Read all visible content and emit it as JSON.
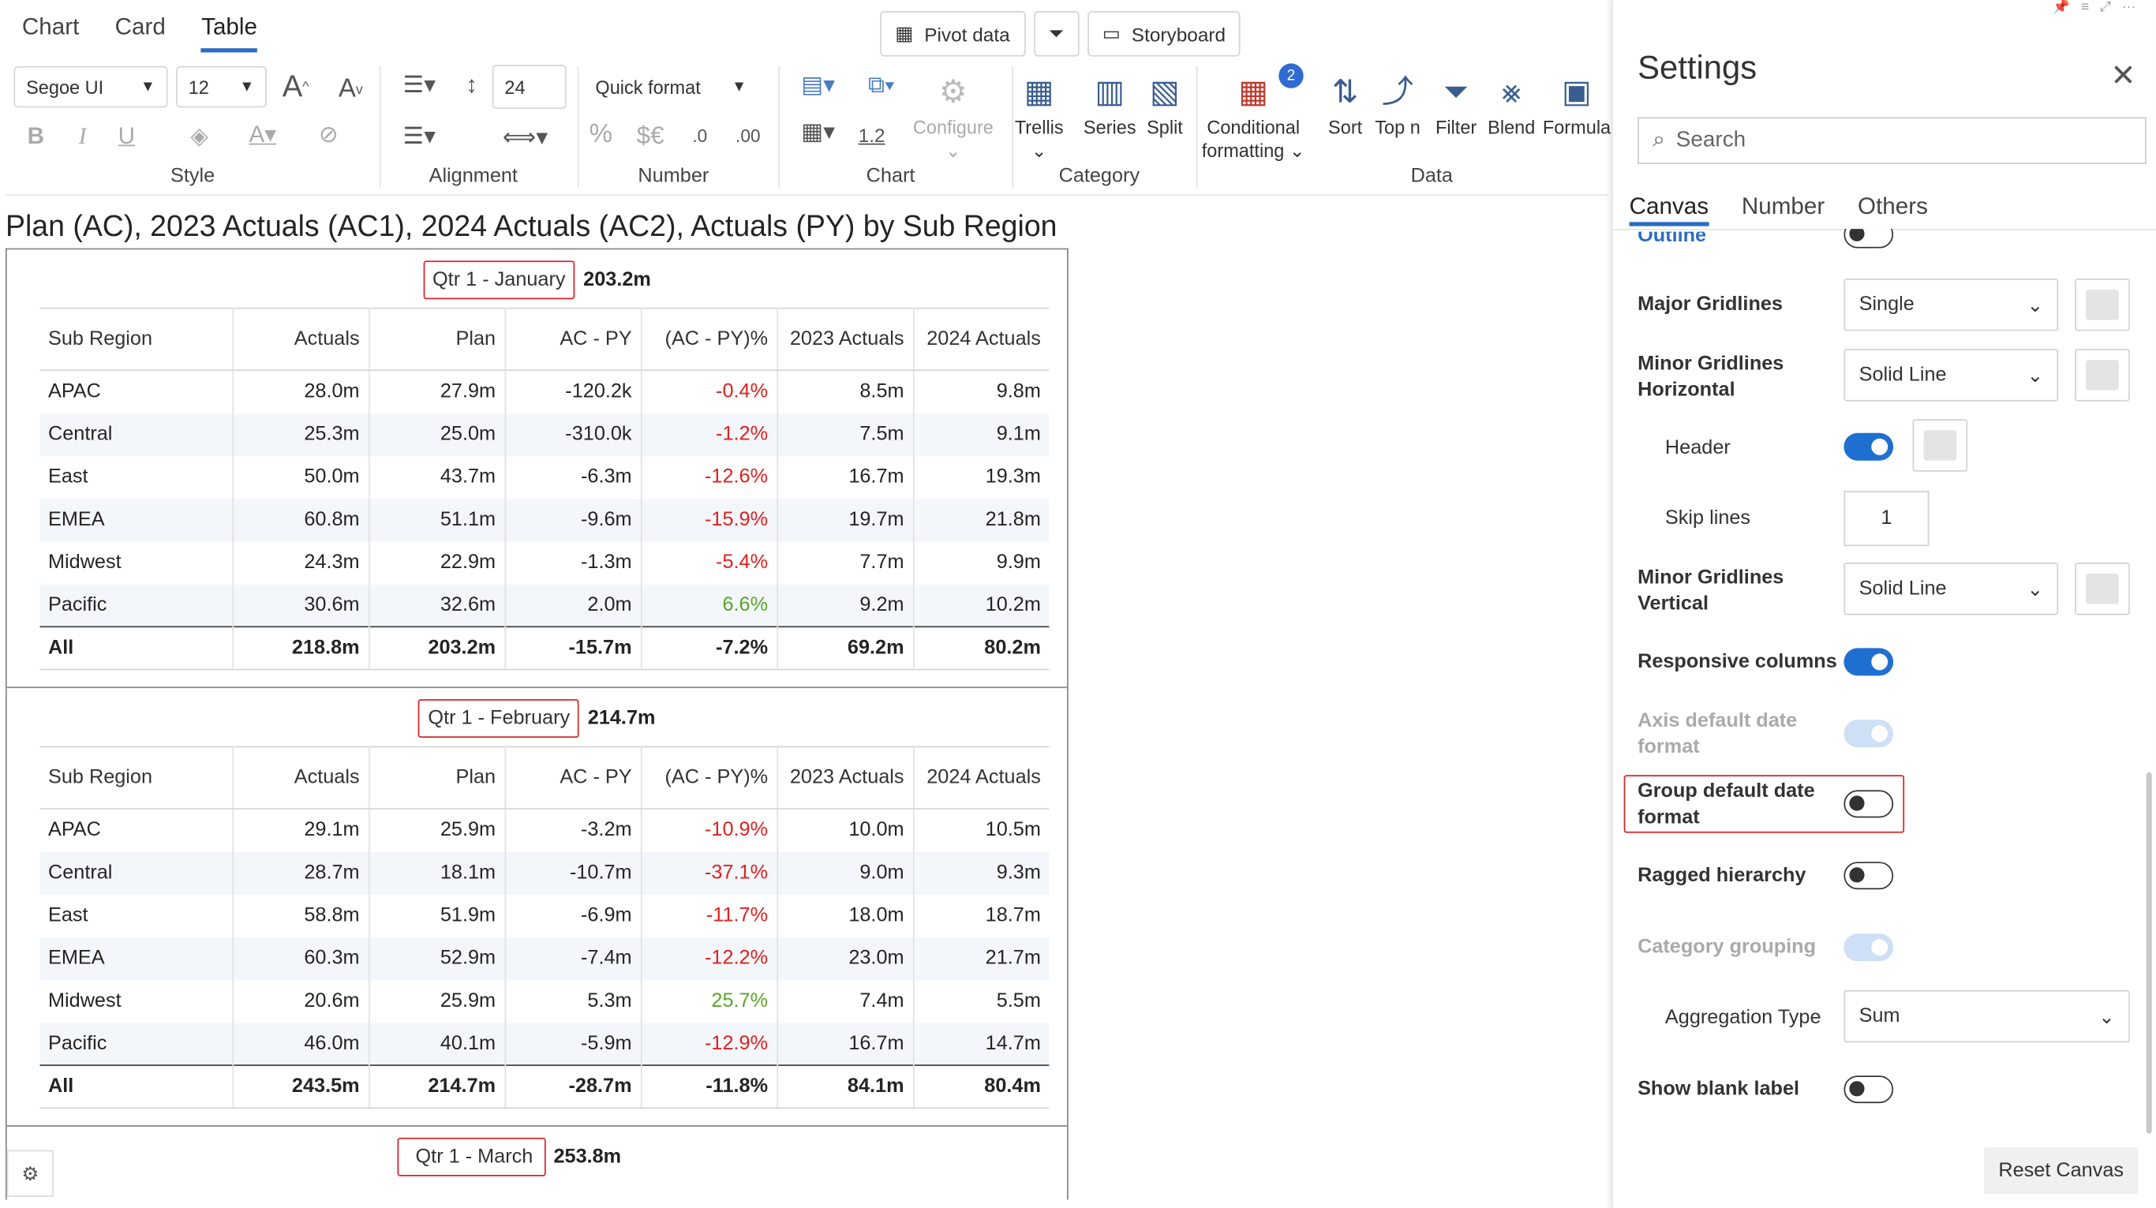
{
  "view_tabs": {
    "chart": "Chart",
    "card": "Card",
    "table": "Table"
  },
  "top_buttons": {
    "pivot": "Pivot data",
    "storyboard": "Storyboard"
  },
  "ribbon": {
    "font_name": "Segoe UI",
    "font_size": "12",
    "row_height": "24",
    "quick_format": "Quick format",
    "number_icons": {
      "percent": "%",
      "currency": "$€",
      "dec_less": ".0",
      "dec_more": ".00"
    },
    "chart_value": "1.2",
    "configure": "Configure",
    "groups": {
      "style": "Style",
      "alignment": "Alignment",
      "number": "Number",
      "chart": "Chart",
      "category": "Category",
      "data": "Data"
    },
    "buttons": {
      "trellis": "Trellis",
      "series": "Series",
      "split": "Split",
      "conditional_formatting_line1": "Conditional",
      "conditional_formatting_line2": "formatting",
      "conditional_badge": "2",
      "sort": "Sort",
      "top_n": "Top n",
      "filter": "Filter",
      "blend": "Blend",
      "formula": "Formula"
    }
  },
  "chart_title": "Plan (AC), 2023 Actuals (AC1), 2024 Actuals (AC2), Actuals (PY) by Sub Region",
  "columns": [
    "Sub Region",
    "Actuals",
    "Plan",
    "AC - PY",
    "(AC - PY)%",
    "2023 Actuals",
    "2024 Actuals"
  ],
  "panels": [
    {
      "label": "Qtr 1 - January",
      "value": "203.2m",
      "rows": [
        [
          "APAC",
          "28.0m",
          "27.9m",
          "-120.2k",
          "-0.4%",
          "8.5m",
          "9.8m"
        ],
        [
          "Central",
          "25.3m",
          "25.0m",
          "-310.0k",
          "-1.2%",
          "7.5m",
          "9.1m"
        ],
        [
          "East",
          "50.0m",
          "43.7m",
          "-6.3m",
          "-12.6%",
          "16.7m",
          "19.3m"
        ],
        [
          "EMEA",
          "60.8m",
          "51.1m",
          "-9.6m",
          "-15.9%",
          "19.7m",
          "21.8m"
        ],
        [
          "Midwest",
          "24.3m",
          "22.9m",
          "-1.3m",
          "-5.4%",
          "7.7m",
          "9.9m"
        ],
        [
          "Pacific",
          "30.6m",
          "32.6m",
          "2.0m",
          "6.6%",
          "9.2m",
          "10.2m"
        ]
      ],
      "total": [
        "All",
        "218.8m",
        "203.2m",
        "-15.7m",
        "-7.2%",
        "69.2m",
        "80.2m"
      ]
    },
    {
      "label": "Qtr 1 - February",
      "value": "214.7m",
      "rows": [
        [
          "APAC",
          "29.1m",
          "25.9m",
          "-3.2m",
          "-10.9%",
          "10.0m",
          "10.5m"
        ],
        [
          "Central",
          "28.7m",
          "18.1m",
          "-10.7m",
          "-37.1%",
          "9.0m",
          "9.3m"
        ],
        [
          "East",
          "58.8m",
          "51.9m",
          "-6.9m",
          "-11.7%",
          "18.0m",
          "18.7m"
        ],
        [
          "EMEA",
          "60.3m",
          "52.9m",
          "-7.4m",
          "-12.2%",
          "23.0m",
          "21.7m"
        ],
        [
          "Midwest",
          "20.6m",
          "25.9m",
          "5.3m",
          "25.7%",
          "7.4m",
          "5.5m"
        ],
        [
          "Pacific",
          "46.0m",
          "40.1m",
          "-5.9m",
          "-12.9%",
          "16.7m",
          "14.7m"
        ]
      ],
      "total": [
        "All",
        "243.5m",
        "214.7m",
        "-28.7m",
        "-11.8%",
        "84.1m",
        "80.4m"
      ]
    },
    {
      "label": "Qtr 1 - March",
      "value": "253.8m",
      "rows": [],
      "total": []
    }
  ],
  "colors": {
    "negative": "#e02020",
    "positive": "#5aa628",
    "accent": "#1f6fd1",
    "highlight": "#d9242a"
  },
  "settings": {
    "title": "Settings",
    "search_placeholder": "Search",
    "tabs": {
      "canvas": "Canvas",
      "number": "Number",
      "others": "Others"
    },
    "outline": "Outline",
    "major_gridlines": {
      "label": "Major Gridlines",
      "value": "Single"
    },
    "minor_h": {
      "label_line1": "Minor Gridlines",
      "label_line2": "Horizontal",
      "value": "Solid Line"
    },
    "header": {
      "label": "Header",
      "on": true
    },
    "skip_lines": {
      "label": "Skip lines",
      "value": "1"
    },
    "minor_v": {
      "label_line1": "Minor Gridlines",
      "label_line2": "Vertical",
      "value": "Solid Line"
    },
    "responsive_columns": {
      "label": "Responsive columns",
      "on": true
    },
    "axis_default_date": {
      "label_line1": "Axis default date",
      "label_line2": "format",
      "on": true,
      "disabled": true
    },
    "group_default_date": {
      "label_line1": "Group default date",
      "label_line2": "format",
      "on": false
    },
    "ragged_hierarchy": {
      "label": "Ragged hierarchy",
      "on": false
    },
    "category_grouping": {
      "label": "Category grouping",
      "on": true,
      "disabled": true
    },
    "aggregation_type": {
      "label": "Aggregation Type",
      "value": "Sum"
    },
    "show_blank_label": {
      "label": "Show blank label",
      "on": false
    },
    "reset": "Reset Canvas"
  }
}
